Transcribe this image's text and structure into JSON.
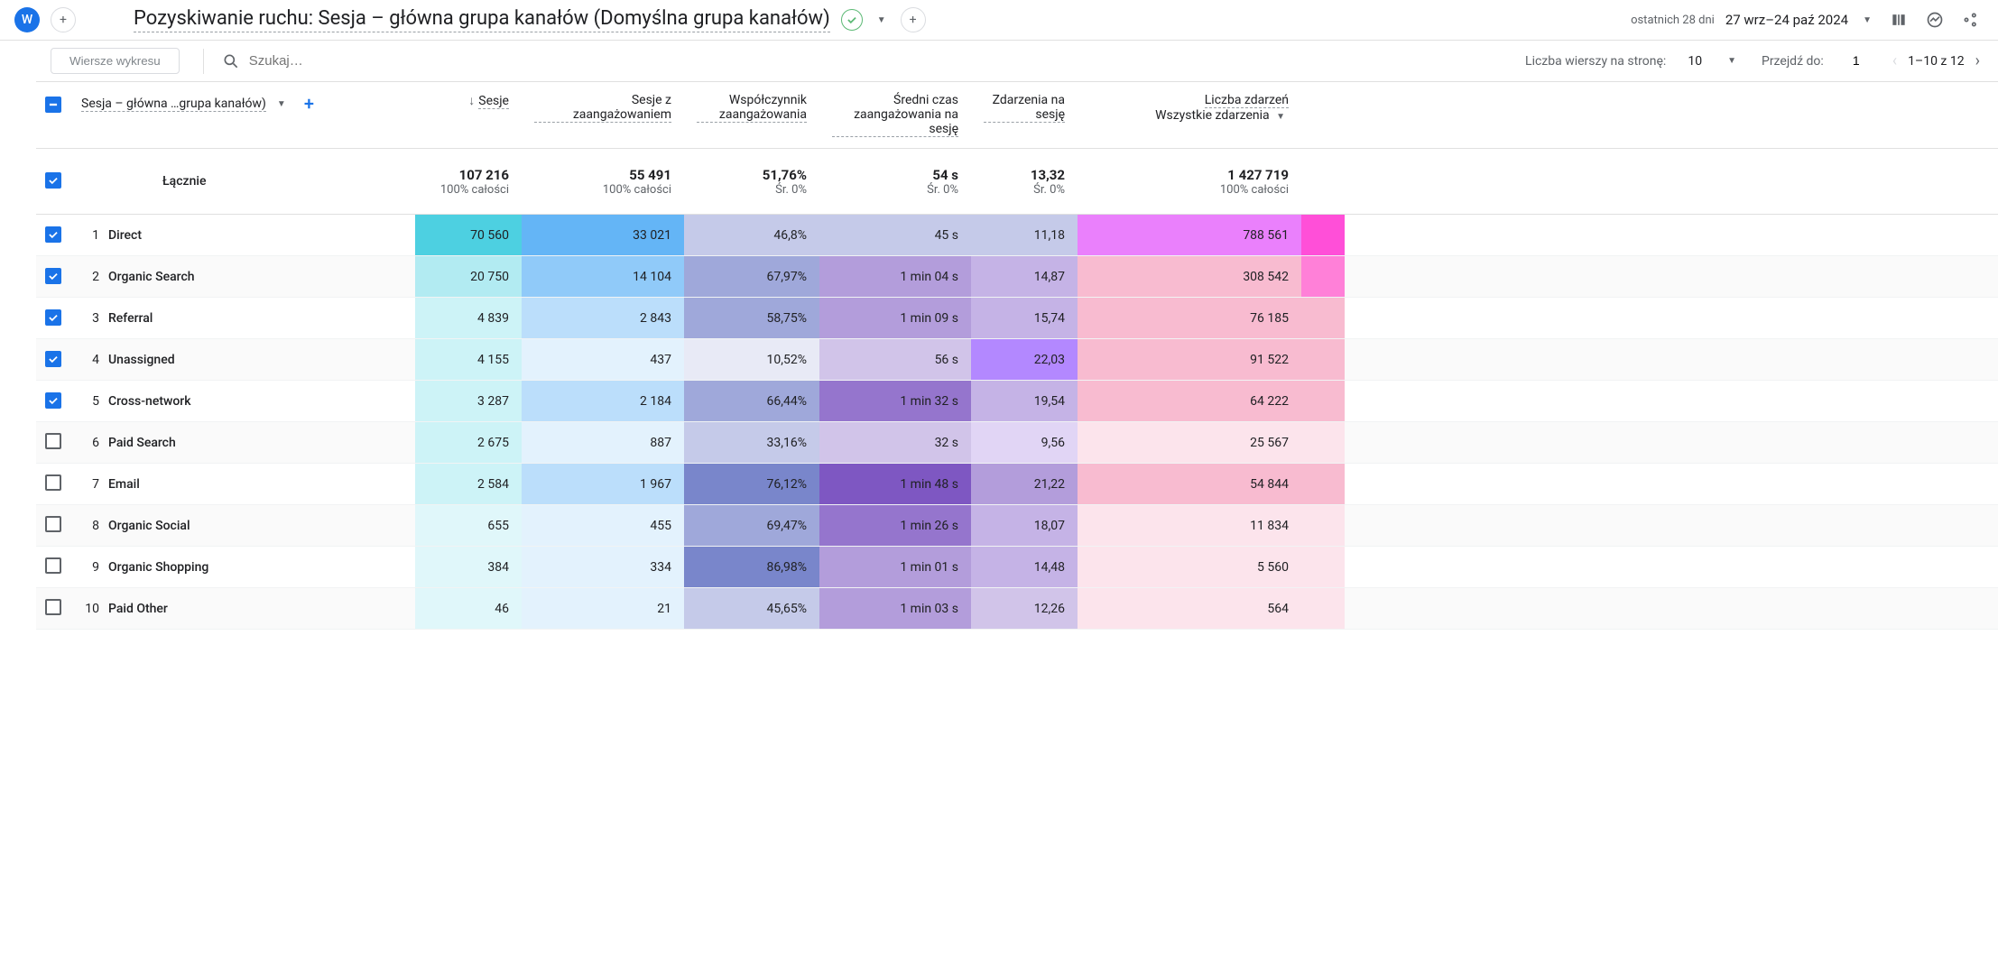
{
  "header": {
    "avatar_letter": "W",
    "title": "Pozyskiwanie ruchu: Sesja – główna grupa kanałów (Domyślna grupa kanałów)",
    "date_label": "ostatnich 28 dni",
    "date_range": "27 wrz–24 paź 2024"
  },
  "toolbar": {
    "chart_rows_label": "Wiersze wykresu",
    "search_placeholder": "Szukaj…",
    "rows_per_page_label": "Liczba wierszy na stronę:",
    "rows_per_page_value": "10",
    "goto_label": "Przejdź do:",
    "goto_value": "1",
    "range_label": "1–10 z 12"
  },
  "table": {
    "dimension_label": "Sesja – główna …grupa kanałów)",
    "total_label": "Łącznie",
    "columns": [
      {
        "label": "Sesje",
        "sort": true
      },
      {
        "label": "Sesje z zaangażowaniem"
      },
      {
        "label": "Współczynnik zaangażowania"
      },
      {
        "label": "Średni czas zaangażowania na sesję"
      },
      {
        "label": "Zdarzenia na sesję"
      },
      {
        "label": "Liczba zdarzeń",
        "sub": "Wszystkie zdarzenia"
      }
    ],
    "totals": {
      "values": [
        "107 216",
        "55 491",
        "51,76%",
        "54 s",
        "13,32",
        "1 427 719"
      ],
      "subs": [
        "100% całości",
        "100% całości",
        "Śr. 0%",
        "Śr. 0%",
        "Śr. 0%",
        "100% całości"
      ]
    },
    "rows": [
      {
        "idx": "1",
        "checked": true,
        "name": "Direct",
        "cells": [
          "70 560",
          "33 021",
          "46,8%",
          "45 s",
          "11,18",
          "788 561"
        ],
        "heat": [
          "#4dd0e1",
          "#64b5f6",
          "#c5cae9",
          "#c5cae9",
          "#c5cae9",
          "#ea80fc"
        ],
        "bar": "#ff4fd8"
      },
      {
        "idx": "2",
        "checked": true,
        "name": "Organic Search",
        "cells": [
          "20 750",
          "14 104",
          "67,97%",
          "1 min 04 s",
          "14,87",
          "308 542"
        ],
        "heat": [
          "#b2ebf2",
          "#90caf9",
          "#9fa8da",
          "#b39ddb",
          "#c5b3e6",
          "#f8bbd0"
        ],
        "bar": "#ff80d8"
      },
      {
        "idx": "3",
        "checked": true,
        "name": "Referral",
        "cells": [
          "4 839",
          "2 843",
          "58,75%",
          "1 min 09 s",
          "15,74",
          "76 185"
        ],
        "heat": [
          "#cdf3f7",
          "#bbdefb",
          "#9fa8da",
          "#b39ddb",
          "#c5b3e6",
          "#f8bbd0"
        ],
        "bar": "#f8bbd0"
      },
      {
        "idx": "4",
        "checked": true,
        "name": "Unassigned",
        "cells": [
          "4 155",
          "437",
          "10,52%",
          "56 s",
          "22,03",
          "91 522"
        ],
        "heat": [
          "#cdf3f7",
          "#e3f2fd",
          "#e8eaf6",
          "#d1c4e9",
          "#b388ff",
          "#f8bbd0"
        ],
        "bar": "#f8bbd0"
      },
      {
        "idx": "5",
        "checked": true,
        "name": "Cross-network",
        "cells": [
          "3 287",
          "2 184",
          "66,44%",
          "1 min 32 s",
          "19,54",
          "64 222"
        ],
        "heat": [
          "#cdf3f7",
          "#bbdefb",
          "#9fa8da",
          "#9575cd",
          "#c5b3e6",
          "#f8bbd0"
        ],
        "bar": "#f8bbd0"
      },
      {
        "idx": "6",
        "checked": false,
        "name": "Paid Search",
        "cells": [
          "2 675",
          "887",
          "33,16%",
          "32 s",
          "9,56",
          "25 567"
        ],
        "heat": [
          "#cdf3f7",
          "#e3f2fd",
          "#c5cae9",
          "#d1c4e9",
          "#e1d5f5",
          "#fce4ec"
        ],
        "bar": "#fce4ec"
      },
      {
        "idx": "7",
        "checked": false,
        "name": "Email",
        "cells": [
          "2 584",
          "1 967",
          "76,12%",
          "1 min 48 s",
          "21,22",
          "54 844"
        ],
        "heat": [
          "#cdf3f7",
          "#bbdefb",
          "#7986cb",
          "#7e57c2",
          "#b39ddb",
          "#f8bbd0"
        ],
        "bar": "#f8bbd0"
      },
      {
        "idx": "8",
        "checked": false,
        "name": "Organic Social",
        "cells": [
          "655",
          "455",
          "69,47%",
          "1 min 26 s",
          "18,07",
          "11 834"
        ],
        "heat": [
          "#e0f7fa",
          "#e3f2fd",
          "#9fa8da",
          "#9575cd",
          "#c5b3e6",
          "#fce4ec"
        ],
        "bar": "#fce4ec"
      },
      {
        "idx": "9",
        "checked": false,
        "name": "Organic Shopping",
        "cells": [
          "384",
          "334",
          "86,98%",
          "1 min 01 s",
          "14,48",
          "5 560"
        ],
        "heat": [
          "#e0f7fa",
          "#e3f2fd",
          "#7986cb",
          "#b39ddb",
          "#c5b3e6",
          "#fce4ec"
        ],
        "bar": "#fce4ec"
      },
      {
        "idx": "10",
        "checked": false,
        "name": "Paid Other",
        "cells": [
          "46",
          "21",
          "45,65%",
          "1 min 03 s",
          "12,26",
          "564"
        ],
        "heat": [
          "#e0f7fa",
          "#e3f2fd",
          "#c5cae9",
          "#b39ddb",
          "#d1c4e9",
          "#fce4ec"
        ],
        "bar": "#fce4ec"
      }
    ]
  }
}
